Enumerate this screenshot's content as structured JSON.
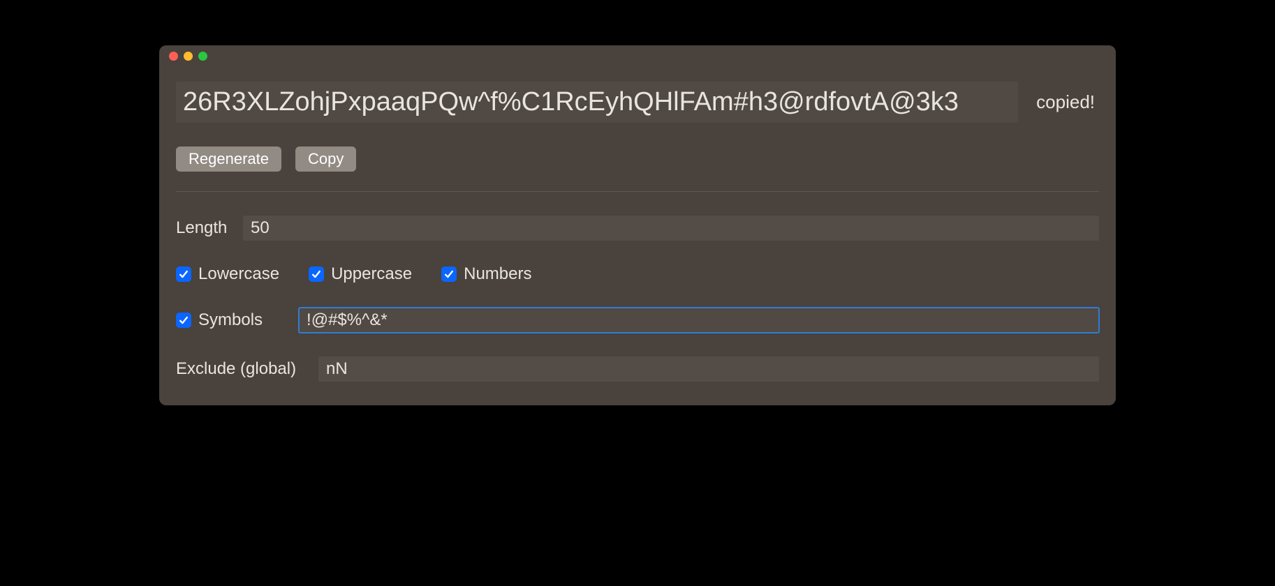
{
  "output": {
    "password": "26R3XLZohjPxpaaqPQw^f%C1RcEyhQHlFAm#h3@rdfovtA@3k3",
    "status": "copied!"
  },
  "buttons": {
    "regenerate": "Regenerate",
    "copy": "Copy"
  },
  "length": {
    "label": "Length",
    "value": "50"
  },
  "options": {
    "lowercase": {
      "label": "Lowercase",
      "checked": true
    },
    "uppercase": {
      "label": "Uppercase",
      "checked": true
    },
    "numbers": {
      "label": "Numbers",
      "checked": true
    },
    "symbols": {
      "label": "Symbols",
      "checked": true,
      "chars": "!@#$%^&*"
    }
  },
  "exclude": {
    "label": "Exclude (global)",
    "value": "nN"
  }
}
